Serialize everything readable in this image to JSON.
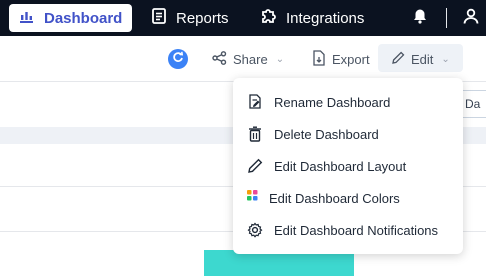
{
  "nav": {
    "items": [
      {
        "label": "Dashboard",
        "icon": "bar-chart-icon",
        "active": true
      },
      {
        "label": "Reports",
        "icon": "document-icon",
        "active": false
      },
      {
        "label": "Integrations",
        "icon": "puzzle-icon",
        "active": false
      }
    ],
    "notifications_icon": "bell-icon",
    "profile_icon": "user-icon"
  },
  "toolbar": {
    "refresh_icon": "refresh-icon",
    "share_label": "Share",
    "export_label": "Export",
    "edit_label": "Edit"
  },
  "partial_field_text": "ly Da",
  "edit_menu": {
    "items": [
      {
        "label": "Rename Dashboard",
        "icon": "rename-icon"
      },
      {
        "label": "Delete Dashboard",
        "icon": "trash-icon"
      },
      {
        "label": "Edit Dashboard Layout",
        "icon": "pencil-icon"
      },
      {
        "label": "Edit Dashboard Colors",
        "icon": "color-palette-icon"
      },
      {
        "label": "Edit Dashboard Notifications",
        "icon": "gear-icon"
      }
    ]
  },
  "colors": {
    "nav_bg": "#0b1220",
    "accent": "#4152c8",
    "refresh": "#3b82f6",
    "teal": "#3dd8cf"
  }
}
